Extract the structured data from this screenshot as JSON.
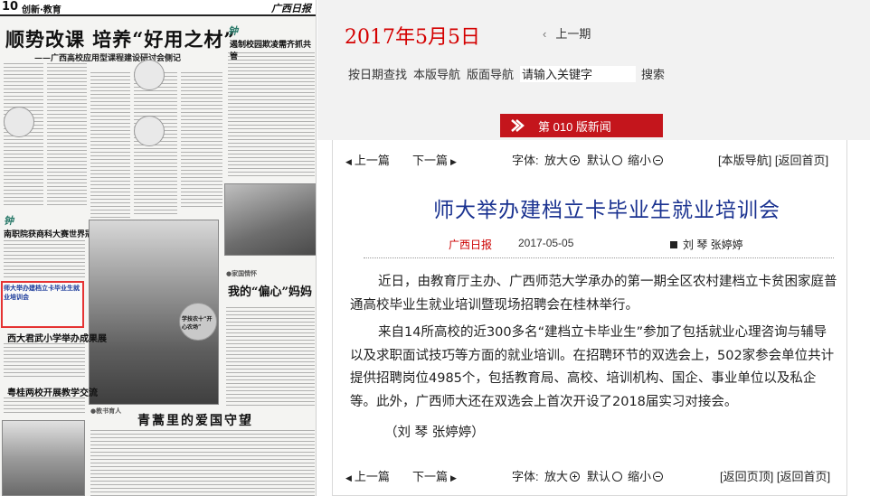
{
  "newspaper": {
    "page_number": "10",
    "section": "创新·教育",
    "masthead": "广西日报",
    "headline": "顺势改课  培养“好用之材”",
    "subheadline": "——广西高校应用型课程建设研讨会侧记",
    "right_top_headline": "遏制校园欺凌需齐抓共管",
    "mid_left_headline": "南职院获商科大赛世界冠军",
    "highlighted_article": "师大举办建档立卡毕业生就业培训会",
    "lower_headline_1": "西大君武小学举办成果展",
    "lower_headline_2": "粤桂两校开展教学交流",
    "feature_headline": "我的“偏心”妈妈",
    "bottom_headline": "青蒿里的爱国守望",
    "badge_text": "学技农十“开心农场”"
  },
  "header": {
    "date_title": "2017年5月5日",
    "prev_issue": "上一期",
    "nav": {
      "by_date": "按日期查找",
      "page_nav": "本版导航",
      "layout_nav": "版面导航",
      "search_placeholder": "请输入关键字",
      "search_button": "搜索"
    },
    "page_banner": "第 010 版新闻"
  },
  "article_nav": {
    "prev": "上一篇",
    "next": "下一篇",
    "font_label": "字体:",
    "enlarge": "放大",
    "default": "默认",
    "shrink": "缩小",
    "top_links": "[本版导航] [返回首页]",
    "bottom_links": "[返回页顶] [返回首页]"
  },
  "article": {
    "title": "师大举办建档立卡毕业生就业培训会",
    "source": "广西日报",
    "date": "2017-05-05",
    "author": "刘 琴 张婷婷",
    "paragraphs": [
      "近日，由教育厅主办、广西师范大学承办的第一期全区农村建档立卡贫困家庭普通高校毕业生就业培训暨现场招聘会在桂林举行。",
      "来自14所高校的近300多名“建档立卡毕业生”参加了包括就业心理咨询与辅导以及求职面试技巧等方面的就业培训。在招聘环节的双选会上，502家参会单位共计提供招聘岗位4985个，包括教育局、高校、培训机构、国企、事业单位以及私企等。此外，广西师大还在双选会上首次开设了2018届实习对接会。",
      "（刘 琴 张婷婷）"
    ]
  },
  "colors": {
    "date_red": "#d40000",
    "banner_red": "#c4151c",
    "title_blue": "#1a3290",
    "highlight_box": "#e53333"
  }
}
